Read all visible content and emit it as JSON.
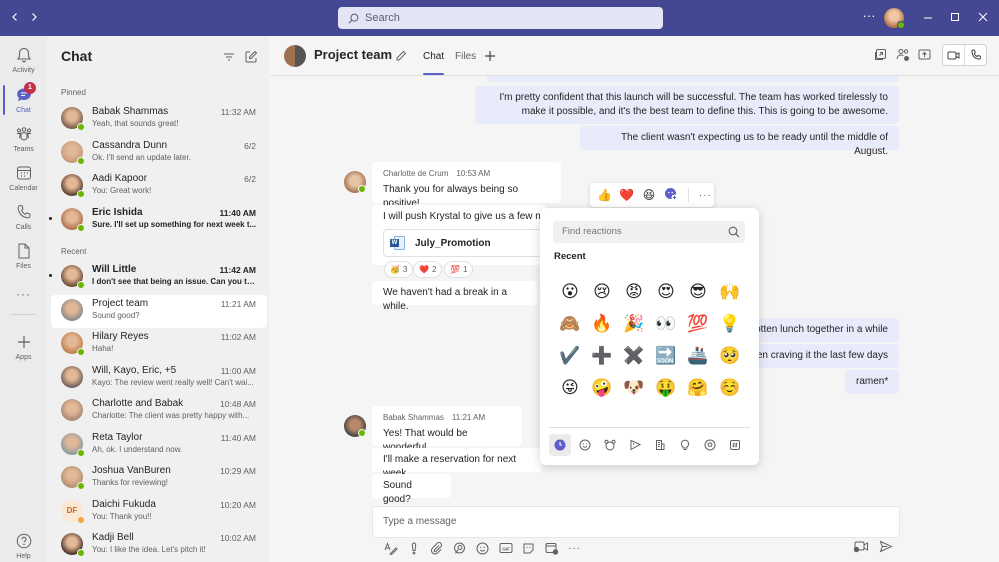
{
  "titlebar": {
    "back_icon": "chevron-left-icon",
    "forward_icon": "chevron-right-icon",
    "search_placeholder": "Search",
    "more_label": "···",
    "window_controls": [
      "minimize",
      "maximize",
      "close"
    ]
  },
  "rail": {
    "items": [
      {
        "label": "Activity",
        "icon": "bell-icon"
      },
      {
        "label": "Chat",
        "icon": "chat-icon",
        "badge": "1",
        "active": true
      },
      {
        "label": "Teams",
        "icon": "teams-icon"
      },
      {
        "label": "Calendar",
        "icon": "calendar-icon"
      },
      {
        "label": "Calls",
        "icon": "phone-icon"
      },
      {
        "label": "Files",
        "icon": "file-icon"
      }
    ],
    "more_label": "···",
    "apps_label": "Apps",
    "help_label": "Help"
  },
  "chatlist": {
    "title": "Chat",
    "pinned_label": "Pinned",
    "recent_label": "Recent",
    "pinned": [
      {
        "name": "Babak Shammas",
        "preview": "Yeah, that sounds great!",
        "time": "11:32 AM",
        "status": "available"
      },
      {
        "name": "Cassandra Dunn",
        "preview": "Ok. I'll send an update later.",
        "time": "6/2",
        "status": "available"
      },
      {
        "name": "Aadi Kapoor",
        "preview": "You: Great work!",
        "time": "6/2",
        "status": "available"
      },
      {
        "name": "Eric Ishida",
        "preview": "Sure. I'll set up something for next week t...",
        "time": "11:40 AM",
        "status": "available",
        "unread": true
      }
    ],
    "recent": [
      {
        "name": "Will Little",
        "preview": "I don't see that being an issue. Can you ta...",
        "time": "11:42 AM",
        "status": "available",
        "unread": true
      },
      {
        "name": "Project team",
        "preview": "Sound good?",
        "time": "11:21 AM",
        "selected": true
      },
      {
        "name": "Hilary Reyes",
        "preview": "Haha!",
        "time": "11:02 AM",
        "status": "available"
      },
      {
        "name": "Will, Kayo, Eric, +5",
        "preview": "Kayo: The review went really well! Can't wai...",
        "time": "11:00 AM"
      },
      {
        "name": "Charlotte and Babak",
        "preview": "Charlotte: The client was pretty happy with...",
        "time": "10:48 AM"
      },
      {
        "name": "Reta Taylor",
        "preview": "Ah, ok. I understand now.",
        "time": "11:40 AM",
        "status": "available"
      },
      {
        "name": "Joshua VanBuren",
        "preview": "Thanks for reviewing!",
        "time": "10:29 AM",
        "status": "available"
      },
      {
        "name": "Daichi Fukuda",
        "preview": "You: Thank you!!",
        "time": "10:20 AM",
        "status": "away",
        "initials": "DF"
      },
      {
        "name": "Kadji Bell",
        "preview": "You: I like the idea. Let's pitch it!",
        "time": "10:02 AM",
        "status": "available"
      }
    ]
  },
  "header": {
    "title": "Project team",
    "tabs": [
      {
        "label": "Chat",
        "active": true
      },
      {
        "label": "Files"
      }
    ],
    "add_tab": "+"
  },
  "messages": {
    "mine_1": "I'm pretty confident that this launch will be successful. The team has worked tirelessly to make it possible, and it's the best team to define this. This is going to be awesome.",
    "mine_2": "The client wasn't expecting us to be ready until the middle of August.",
    "charlotte": {
      "author": "Charlotte de Crum",
      "time": "10:53 AM",
      "msg1": "Thank you for always being so positive!",
      "msg2": "I will push Krystal to give us a few mo",
      "file": "July_Promotion",
      "reactions": [
        {
          "emoji": "🥳",
          "count": "3"
        },
        {
          "emoji": "❤️",
          "count": "2"
        },
        {
          "emoji": "💯",
          "count": "1"
        }
      ],
      "msg3": "We haven't had a break in a while."
    },
    "mine_3": "otten lunch together in a while.",
    "mine_4": "en craving it the last few days.",
    "mine_5": "ramen*",
    "babak": {
      "author": "Babak Shammas",
      "time": "11:21 AM",
      "msg1": "Yes! That would be wonderful.",
      "msg2": "I'll make a reservation for next week.",
      "msg3": "Sound good?"
    }
  },
  "reaction_bar": {
    "emojis": [
      "👍",
      "❤️",
      "😆"
    ],
    "more_reactions_icon": "emoji-add-icon",
    "more_label": "···"
  },
  "picker": {
    "search_placeholder": "Find reactions",
    "recent_label": "Recent",
    "emojis": [
      "😮",
      "😢",
      "😡",
      "😍",
      "😎",
      "🙌",
      "🙈",
      "🔥",
      "🎉",
      "👀",
      "💯",
      "💡",
      "✔️",
      "➕",
      "✖️",
      "🔜",
      "🚢",
      "🥺",
      "😜",
      "🤪",
      "🐶",
      "🤑",
      "🤗",
      "☺️"
    ],
    "categories": [
      "recent-icon",
      "smiley-icon",
      "animal-icon",
      "food-icon",
      "building-icon",
      "lightbulb-icon",
      "ball-icon",
      "symbols-icon"
    ]
  },
  "compose": {
    "placeholder": "Type a message",
    "tools": [
      "format-icon",
      "important-icon",
      "attach-icon",
      "loop-icon",
      "emoji-icon",
      "gif-icon",
      "sticker-icon",
      "schedule-meeting-icon",
      "more-icon"
    ],
    "more_label": "···"
  }
}
